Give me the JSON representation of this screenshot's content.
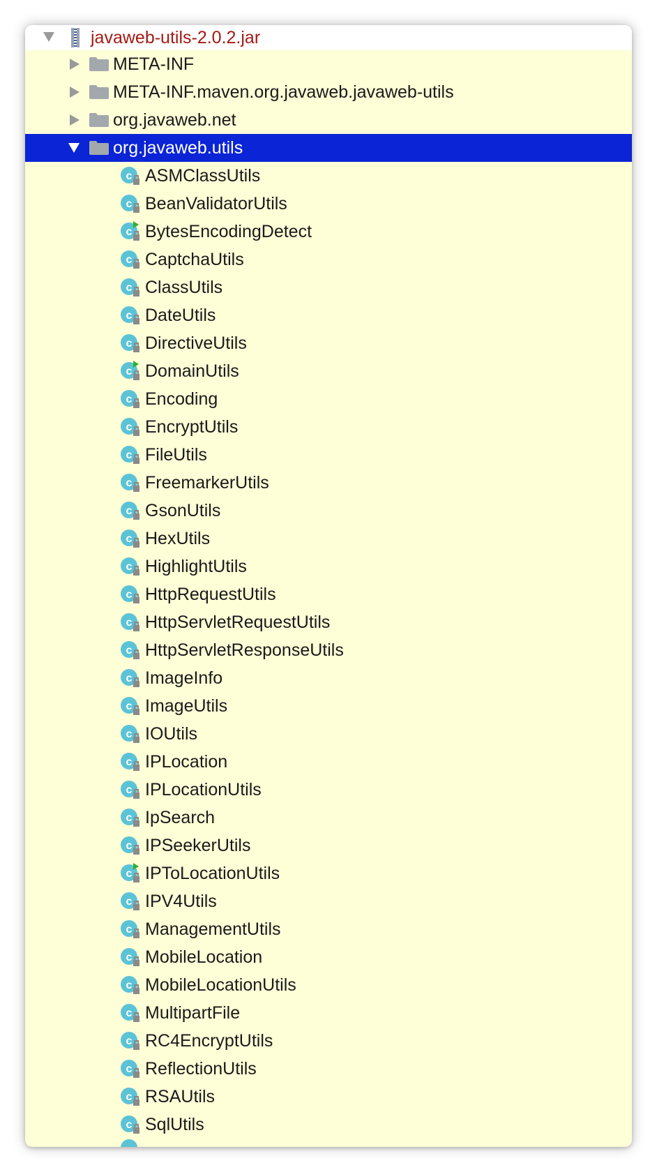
{
  "tree": {
    "root": {
      "label": "javaweb-utils-2.0.2.jar",
      "icon": "jar-archive-icon",
      "expanded": true
    },
    "folders": [
      {
        "label": "META-INF",
        "expanded": false,
        "selected": false
      },
      {
        "label": "META-INF.maven.org.javaweb.javaweb-utils",
        "expanded": false,
        "selected": false
      },
      {
        "label": "org.javaweb.net",
        "expanded": false,
        "selected": false
      },
      {
        "label": "org.javaweb.utils",
        "expanded": true,
        "selected": true
      }
    ],
    "classes": [
      {
        "label": "ASMClassUtils",
        "runnable": false
      },
      {
        "label": "BeanValidatorUtils",
        "runnable": false
      },
      {
        "label": "BytesEncodingDetect",
        "runnable": true
      },
      {
        "label": "CaptchaUtils",
        "runnable": false
      },
      {
        "label": "ClassUtils",
        "runnable": false
      },
      {
        "label": "DateUtils",
        "runnable": false
      },
      {
        "label": "DirectiveUtils",
        "runnable": false
      },
      {
        "label": "DomainUtils",
        "runnable": true
      },
      {
        "label": "Encoding",
        "runnable": false
      },
      {
        "label": "EncryptUtils",
        "runnable": false
      },
      {
        "label": "FileUtils",
        "runnable": false
      },
      {
        "label": "FreemarkerUtils",
        "runnable": false
      },
      {
        "label": "GsonUtils",
        "runnable": false
      },
      {
        "label": "HexUtils",
        "runnable": false
      },
      {
        "label": "HighlightUtils",
        "runnable": false
      },
      {
        "label": "HttpRequestUtils",
        "runnable": false
      },
      {
        "label": "HttpServletRequestUtils",
        "runnable": false
      },
      {
        "label": "HttpServletResponseUtils",
        "runnable": false
      },
      {
        "label": "ImageInfo",
        "runnable": false
      },
      {
        "label": "ImageUtils",
        "runnable": false
      },
      {
        "label": "IOUtils",
        "runnable": false
      },
      {
        "label": "IPLocation",
        "runnable": false
      },
      {
        "label": "IPLocationUtils",
        "runnable": false
      },
      {
        "label": "IpSearch",
        "runnable": false
      },
      {
        "label": "IPSeekerUtils",
        "runnable": false
      },
      {
        "label": "IPToLocationUtils",
        "runnable": true
      },
      {
        "label": "IPV4Utils",
        "runnable": false
      },
      {
        "label": "ManagementUtils",
        "runnable": false
      },
      {
        "label": "MobileLocation",
        "runnable": false
      },
      {
        "label": "MobileLocationUtils",
        "runnable": false
      },
      {
        "label": "MultipartFile",
        "runnable": false
      },
      {
        "label": "RC4EncryptUtils",
        "runnable": false
      },
      {
        "label": "ReflectionUtils",
        "runnable": false
      },
      {
        "label": "RSAUtils",
        "runnable": false
      },
      {
        "label": "SqlUtils",
        "runnable": false
      }
    ]
  },
  "colors": {
    "panel_background": "#fefed7",
    "root_row_background": "#ffffff",
    "selection": "#0a24d6",
    "root_label": "#a51a14",
    "folder_icon": "#a3a8ad",
    "class_icon": "#5cc3d6",
    "run_marker": "#2fb12f",
    "lock_badge": "#8a8a8a"
  }
}
